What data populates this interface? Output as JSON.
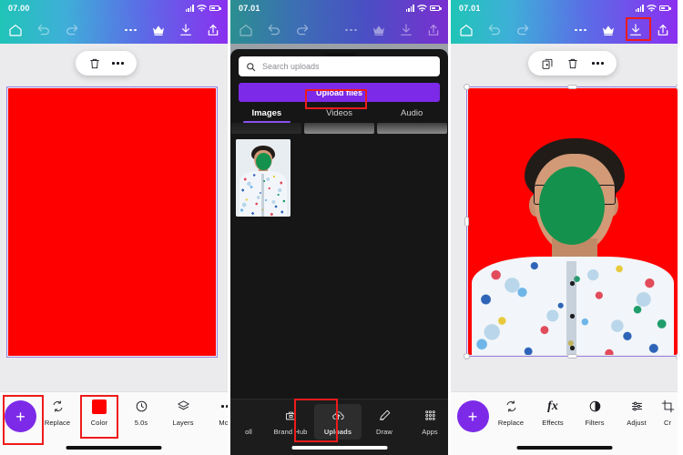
{
  "app": {
    "name": "Canva Mobile Editor"
  },
  "panels": [
    {
      "id": "panel-1",
      "status": {
        "time": "07.00"
      },
      "nav": {
        "home_label": "Home",
        "undo_label": "Undo",
        "redo_label": "Redo",
        "more_label": "More",
        "crown_label": "Pro",
        "download_label": "Download",
        "share_label": "Share"
      },
      "context_menu": {
        "delete_label": "Delete",
        "more_label": "More options"
      },
      "canvas": {
        "fill_color": "#ff0000",
        "selection_color": "#9b7de0"
      },
      "toolbar": {
        "add_label": "+",
        "items": [
          {
            "label": "Replace",
            "icon": "replace-icon"
          },
          {
            "label": "Color",
            "icon": "color-swatch-icon"
          },
          {
            "label": "5.0s",
            "icon": "timer-icon"
          },
          {
            "label": "Layers",
            "icon": "layers-icon"
          },
          {
            "label": "Mor",
            "icon": "more-dots-icon"
          }
        ]
      },
      "annotations": [
        "add-button-highlight",
        "color-tool-highlight"
      ]
    },
    {
      "id": "panel-2",
      "status": {
        "time": "07.01"
      },
      "nav": {
        "home_label": "Home",
        "undo_label": "Undo",
        "redo_label": "Redo",
        "more_label": "More",
        "crown_label": "Pro",
        "download_label": "Download",
        "share_label": "Share"
      },
      "uploads": {
        "search_placeholder": "Search uploads",
        "search_value": "",
        "upload_button_label": "Upload files",
        "upload_button_color": "#7d2ae8",
        "tabs": [
          {
            "label": "Images",
            "active": true
          },
          {
            "label": "Videos",
            "active": false
          },
          {
            "label": "Audio",
            "active": false
          }
        ],
        "items_count": 1
      },
      "toolbar": {
        "items": [
          {
            "label": "oll",
            "icon": "scroll-icon"
          },
          {
            "label": "Brand Hub",
            "icon": "brand-hub-icon"
          },
          {
            "label": "Uploads",
            "icon": "uploads-cloud-icon"
          },
          {
            "label": "Draw",
            "icon": "draw-pen-icon"
          },
          {
            "label": "Apps",
            "icon": "apps-grid-icon"
          }
        ]
      },
      "annotations": [
        "upload-files-highlight",
        "uploads-tab-highlight"
      ]
    },
    {
      "id": "panel-3",
      "status": {
        "time": "07.01"
      },
      "nav": {
        "home_label": "Home",
        "undo_label": "Undo",
        "redo_label": "Redo",
        "more_label": "More",
        "crown_label": "Pro",
        "download_label": "Download",
        "share_label": "Share"
      },
      "context_menu": {
        "duplicate_label": "Duplicate",
        "delete_label": "Delete",
        "more_label": "More options"
      },
      "canvas": {
        "fill_color": "#ff0000",
        "selection_color": "#9b7de0",
        "photo_alt": "Portrait on red background"
      },
      "toolbar": {
        "add_label": "+",
        "items": [
          {
            "label": "Replace",
            "icon": "replace-icon"
          },
          {
            "label": "Effects",
            "icon": "effects-fx-icon"
          },
          {
            "label": "Filters",
            "icon": "filters-icon"
          },
          {
            "label": "Adjust",
            "icon": "adjust-sliders-icon"
          },
          {
            "label": "Cr",
            "icon": "crop-icon"
          }
        ]
      },
      "annotations": [
        "download-button-highlight"
      ]
    }
  ],
  "theme": {
    "accent_purple": "#7d2ae8",
    "annotation_red": "#ee1b1b",
    "canvas_red": "#ff0000",
    "face_mask_green": "#14914d",
    "dark_bg": "#161616"
  }
}
